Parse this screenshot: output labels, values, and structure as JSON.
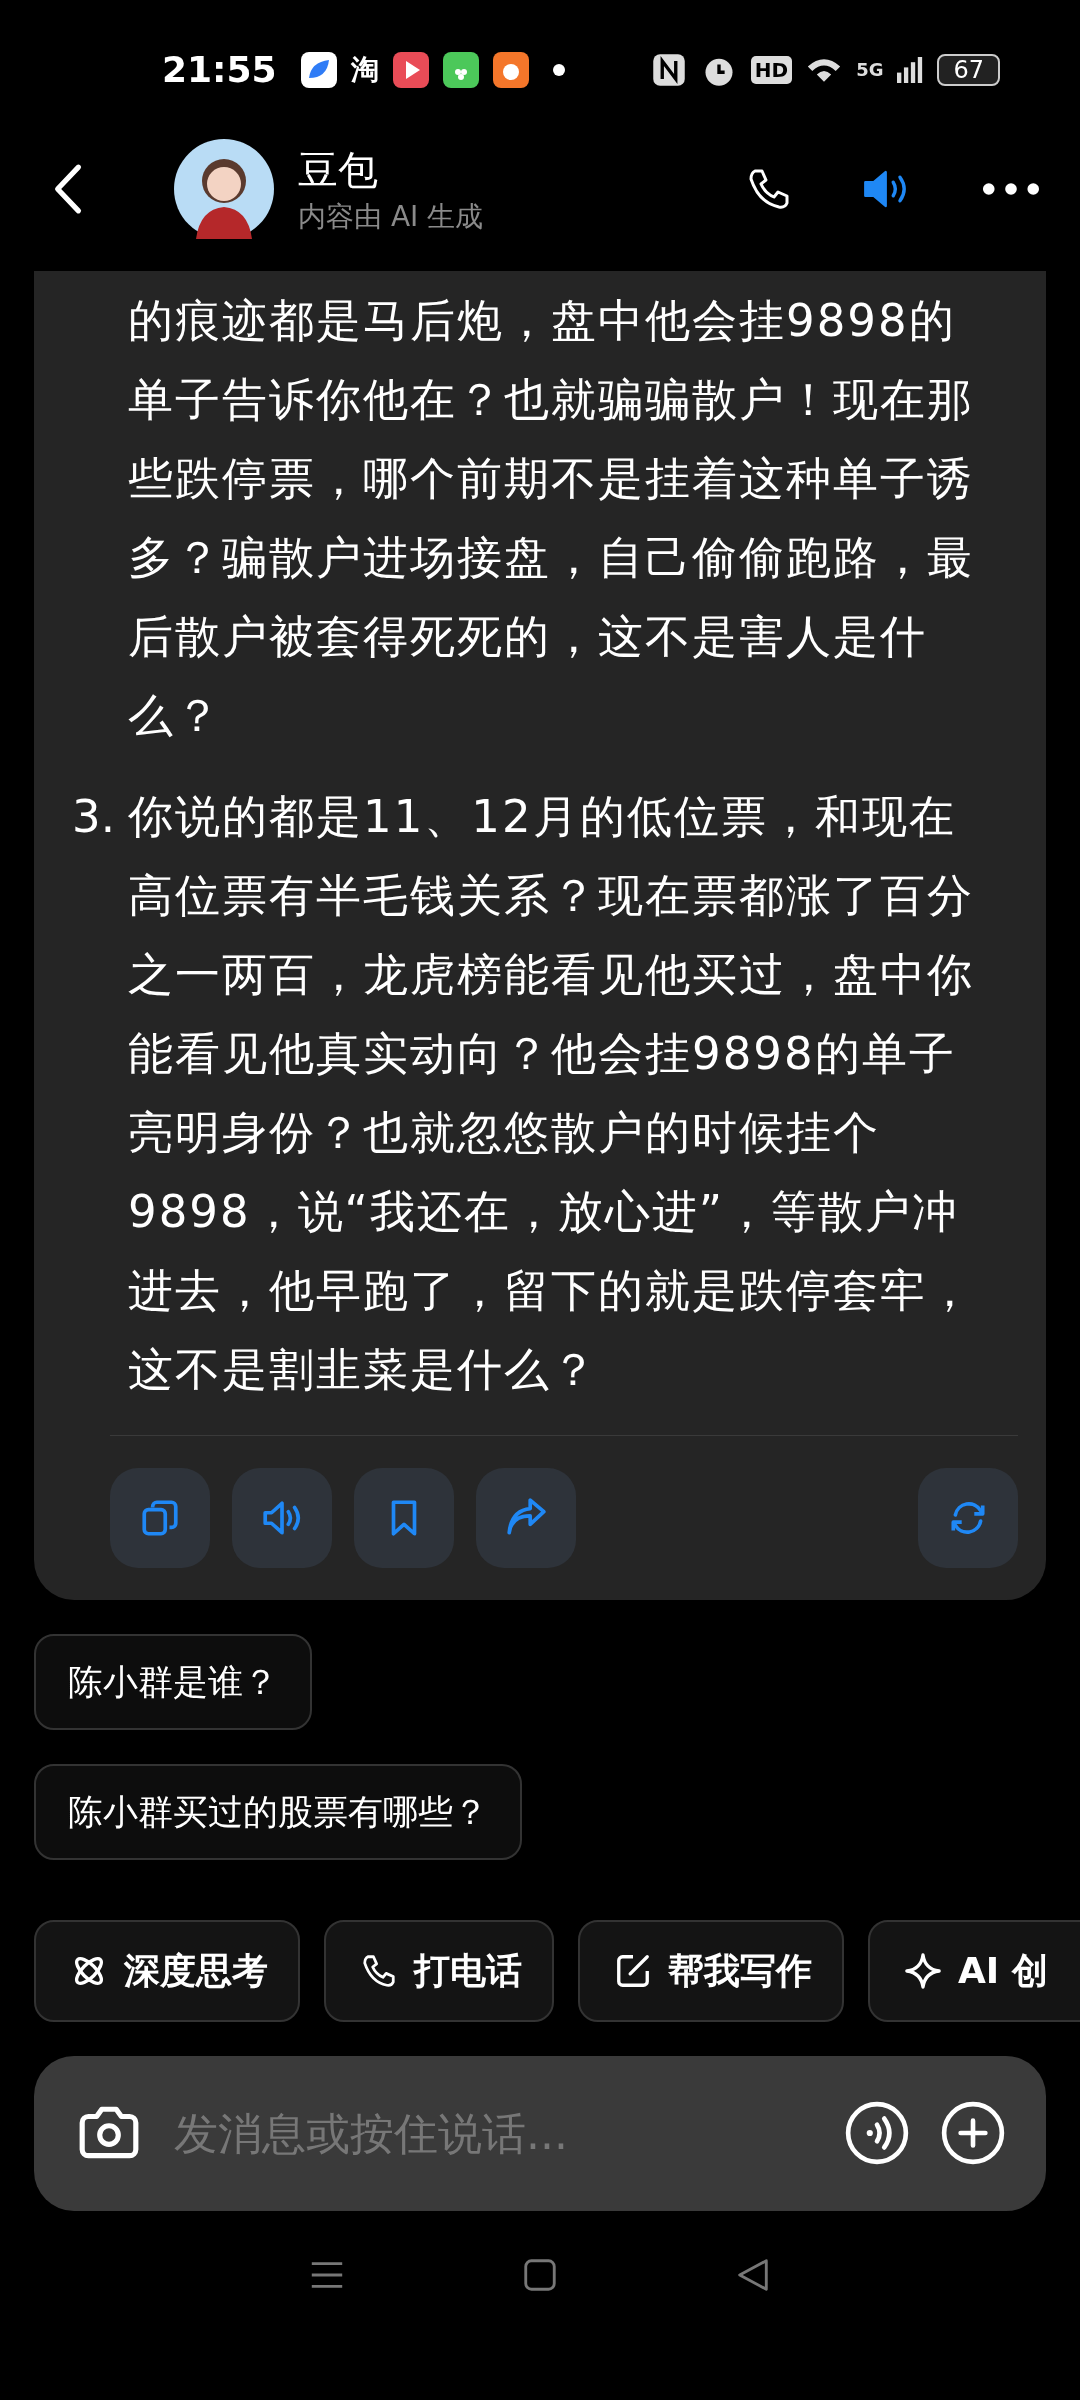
{
  "status_bar": {
    "time": "21:55",
    "app_glyph": "淘",
    "hd": "HD",
    "network": "5G",
    "battery": "67"
  },
  "header": {
    "title": "豆包",
    "subtitle": "内容由 AI 生成"
  },
  "message": {
    "continuation": "的痕迹都是马后炮，盘中他会挂9898的单子告诉你他在？也就骗骗散户！现在那些跌停票，哪个前期不是挂着这种单子诱多？骗散户进场接盘，自己偷偷跑路，最后散户被套得死死的，这不是害人是什么？",
    "items": [
      {
        "number": "3.",
        "text": "你说的都是11、12月的低位票，和现在高位票有半毛钱关系？现在票都涨了百分之一两百，龙虎榜能看见他买过，盘中你能看见他真实动向？他会挂9898的单子亮明身份？也就忽悠散户的时候挂个9898，说“我还在，放心进”，等散户冲进去，他早跑了，留下的就是跌停套牢，这不是割韭菜是什么？"
      }
    ]
  },
  "suggestions": [
    "陈小群是谁？",
    "陈小群买过的股票有哪些？"
  ],
  "chips": [
    {
      "kind": "think",
      "label": "深度思考"
    },
    {
      "kind": "call",
      "label": "打电话"
    },
    {
      "kind": "write",
      "label": "帮我写作"
    },
    {
      "kind": "create",
      "label": "AI 创"
    }
  ],
  "input": {
    "placeholder": "发消息或按住说话..."
  }
}
